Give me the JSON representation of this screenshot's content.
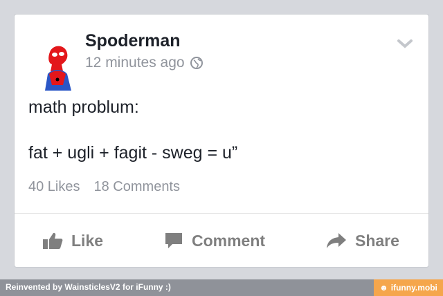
{
  "post": {
    "author": "Spoderman",
    "timestamp": "12 minutes ago",
    "privacy_icon": "globe-icon",
    "lines": [
      "math problum:",
      "",
      "fat + ugli + fagit - sweg = u”"
    ]
  },
  "stats": {
    "likes": "40 Likes",
    "comments": "18 Comments"
  },
  "actions": {
    "like": "Like",
    "comment": "Comment",
    "share": "Share"
  },
  "footer": {
    "credit": "Reinvented by WainsticlesV2 for iFunny :)",
    "brand": "ifunny.mobi"
  },
  "colors": {
    "background": "#d6d8dd",
    "action_gray": "#7f7f7f",
    "footer_gray": "#8f9299",
    "brand_orange": "#f5a64c",
    "avatar_red": "#e3171b"
  }
}
